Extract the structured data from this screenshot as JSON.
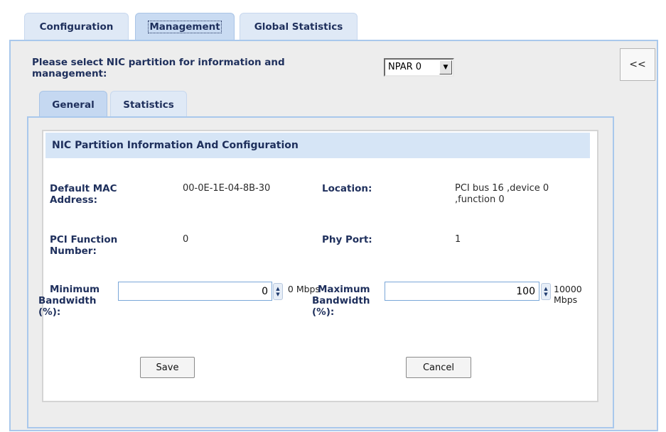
{
  "top_tabs": [
    {
      "label": "Configuration",
      "active": false
    },
    {
      "label": "Management",
      "active": true
    },
    {
      "label": "Global Statistics",
      "active": false
    }
  ],
  "partition_select": {
    "prompt": "Please select NIC partition for information and management:",
    "value": "NPAR 0",
    "arrow_icon": "dropdown-arrow-icon"
  },
  "collapse_button": {
    "label": "<<"
  },
  "sub_tabs": [
    {
      "label": "General",
      "active": true
    },
    {
      "label": "Statistics",
      "active": false
    }
  ],
  "section": {
    "title": "NIC Partition Information And Configuration"
  },
  "info": {
    "mac_label": "Default MAC Address:",
    "mac_value": "00-0E-1E-04-8B-30",
    "location_label": "Location:",
    "location_value": "PCI bus 16 ,device 0 ,function 0",
    "pci_function_label": "PCI Function Number:",
    "pci_function_value": "0",
    "phy_port_label": "Phy Port:",
    "phy_port_value": "1"
  },
  "bandwidth": {
    "min_label": "Minimum Bandwidth (%):",
    "min_value": "0",
    "min_unit": "0 Mbps",
    "max_label": "Maximum Bandwidth (%):",
    "max_value": "100",
    "max_unit": "10000 Mbps"
  },
  "buttons": {
    "save": "Save",
    "cancel": "Cancel"
  },
  "colors": {
    "tab_active": "#c9dbf2",
    "panel_border": "#a9c8ec",
    "header_bg": "#d6e5f6",
    "label_text": "#1e2f5c"
  }
}
